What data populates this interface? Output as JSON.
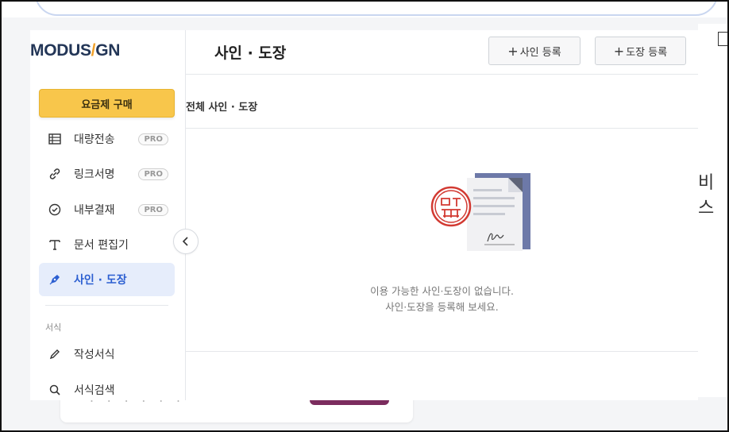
{
  "app": {
    "logo_left": "MODUS",
    "logo_slash": "/",
    "logo_right": "GN",
    "accent_color": "#2c5fd1",
    "buy_color": "#f8c64b"
  },
  "sidebar": {
    "buy_label": "요금제 구매",
    "items": [
      {
        "label": "대량전송",
        "badge": "PRO",
        "icon": "table-icon"
      },
      {
        "label": "링크서명",
        "badge": "PRO",
        "icon": "link-icon"
      },
      {
        "label": "내부결재",
        "badge": "PRO",
        "icon": "check-circle-icon"
      },
      {
        "label": "문서 편집기",
        "icon": "text-t-icon"
      },
      {
        "label": "사인 · 도장",
        "icon": "pen-nib-icon",
        "active": true
      }
    ],
    "section_label": "서식",
    "section_items": [
      {
        "label": "작성서식",
        "icon": "pencil-icon"
      },
      {
        "label": "서식검색",
        "icon": "search-icon"
      }
    ]
  },
  "header": {
    "title": "사인 · 도장",
    "add_sign_label": "사인 등록",
    "add_stamp_label": "도장 등록"
  },
  "main": {
    "subheading": "전체 사인 · 도장",
    "empty_line1": "이용 가능한 사인·도장이 없습니다.",
    "empty_line2": "사인·도장을 등록해 보세요."
  },
  "background": {
    "right_text": "비스"
  }
}
